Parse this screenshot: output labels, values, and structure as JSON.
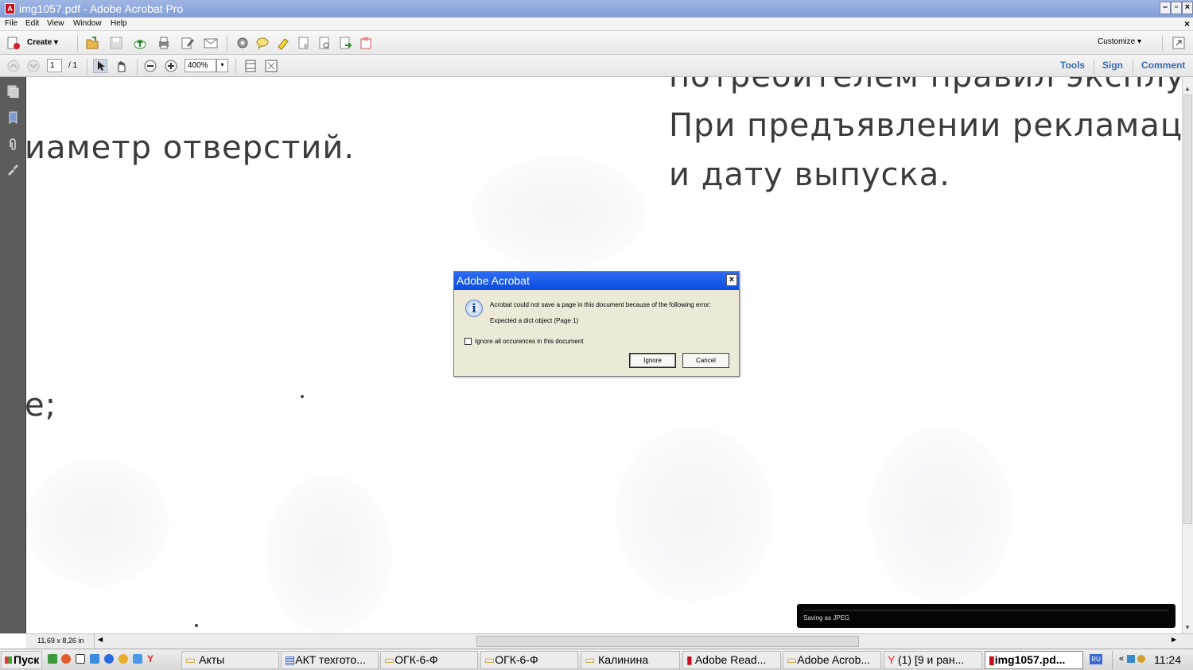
{
  "window": {
    "title": "img1057.pdf - Adobe Acrobat Pro",
    "min": "–",
    "restore": "▫",
    "close": "×",
    "doc_close": "×"
  },
  "menu": [
    "File",
    "Edit",
    "View",
    "Window",
    "Help"
  ],
  "toolbar": {
    "create_label": "Create ▾",
    "customize_label": "Customize ▾"
  },
  "navbar": {
    "page_current": "1",
    "page_total": "/ 1",
    "zoom": "400%",
    "tools": "Tools",
    "sign": "Sign",
    "comment": "Comment"
  },
  "document": {
    "line_left_1": "иаметр отверстий.",
    "line_left_2": "e;",
    "line_right_top": "потребителем правил эксплуа",
    "line_right_1": "При предъявлении рекламац",
    "line_right_2": "и дату выпуска."
  },
  "status": {
    "page_size": "11,69 x 8,26 in"
  },
  "dialog": {
    "title": "Adobe Acrobat",
    "close": "×",
    "message_1": "Acrobat could not save a page in this document because of the following error:",
    "message_2": "Expected a dict object (Page 1)",
    "checkbox_label": "Ignore all occurences in this document",
    "ignore_button": "Ignore",
    "cancel_button": "Cancel"
  },
  "toast": {
    "text": "Saving as JPEG"
  },
  "taskbar": {
    "start": "Пуск",
    "tasks": [
      "Акты",
      "АКТ техгото...",
      "ОГК-6-Ф",
      "ОГК-6-Ф",
      "Калинина",
      "Adobe Read...",
      "Adobe Acrob...",
      "(1) [9 и ран...",
      "img1057.pd..."
    ],
    "lang": "RU",
    "clock": "11:24"
  }
}
